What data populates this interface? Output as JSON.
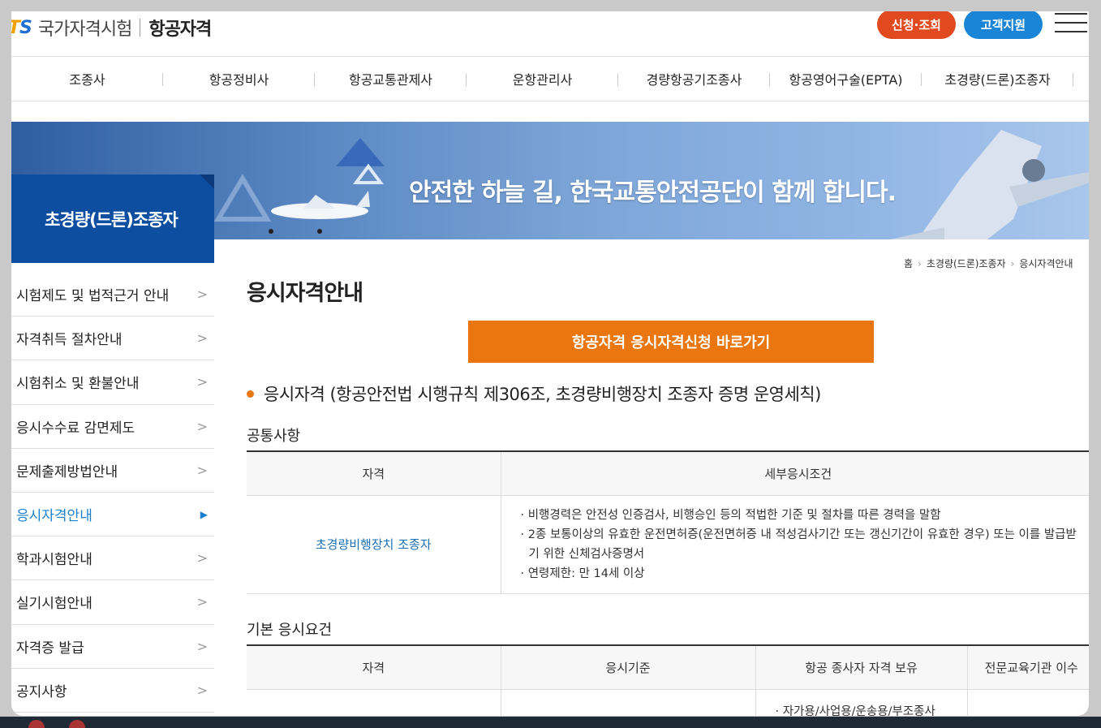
{
  "header": {
    "logo_ts": "TS",
    "logo_sub": "국가자격시험",
    "logo_main": "항공자격",
    "apply_label": "신청·조회",
    "support_label": "고객지원"
  },
  "nav": [
    "조종사",
    "항공정비사",
    "항공교통관제사",
    "운항관리사",
    "경량항공기조종사",
    "항공영어구술(EPTA)",
    "초경량(드론)조종자"
  ],
  "banner": {
    "slogan": "안전한 하늘 길, 한국교통안전공단이 함께 합니다."
  },
  "sidebar": {
    "title": "초경량(드론)조종자",
    "items": [
      {
        "label": "시험제도 및 법적근거 안내",
        "active": false
      },
      {
        "label": "자격취득 절차안내",
        "active": false
      },
      {
        "label": "시험취소 및 환불안내",
        "active": false
      },
      {
        "label": "응시수수료 감면제도",
        "active": false
      },
      {
        "label": "문제출제방법안내",
        "active": false
      },
      {
        "label": "응시자격안내",
        "active": true
      },
      {
        "label": "학과시험안내",
        "active": false
      },
      {
        "label": "실기시험안내",
        "active": false
      },
      {
        "label": "자격증 발급",
        "active": false
      },
      {
        "label": "공지사항",
        "active": false
      }
    ]
  },
  "breadcrumb": [
    "홈",
    "초경량(드론)조종자",
    "응시자격안내"
  ],
  "main": {
    "title": "응시자격안내",
    "cta_label": "항공자격 응시자격신청 바로가기",
    "section_title": "응시자격 (항공안전법 시행규칙 제306조, 초경량비행장치 조종자 증명 운영세칙)",
    "common": {
      "heading": "공통사항",
      "columns": [
        "자격",
        "세부응시조건"
      ],
      "qualification": "초경량비행장치 조종자",
      "conditions": [
        "비행경력은 안전성 인증검사, 비행승인 등의 적법한 기준 및 절차를 따른 경력을 말함",
        "2종 보통이상의 유효한 운전면허증(운전면허증 내 적성검사기간 또는 갱신기간이 유효한 경우) 또는 이를 발급받기 위한 신체검사증명서",
        "연령제한: 만 14세 이상"
      ]
    },
    "basic": {
      "heading": "기본 응시요건",
      "columns": [
        "자격",
        "응시기준",
        "항공 종사자 자격 보유",
        "전문교육기관 이수"
      ],
      "partial_row_text": "· 자가용/사업용/운송용/부조종사"
    }
  },
  "colors": {
    "brand_blue": "#0e4ea0",
    "cta_orange": "#e9760f",
    "apply_red": "#e04a1e",
    "support_blue": "#1a84d6",
    "active_blue": "#1a7fcc"
  }
}
